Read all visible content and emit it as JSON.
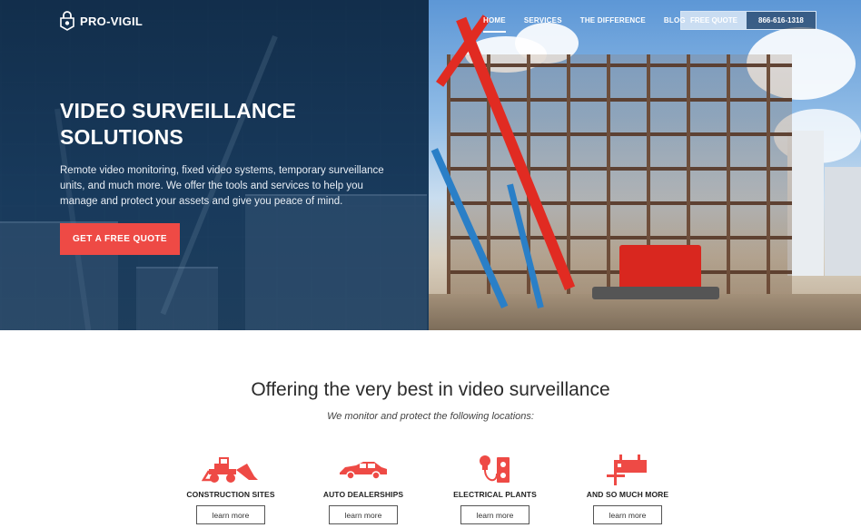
{
  "brand": {
    "name": "PRO-VIGIL",
    "accent": "#ee4a45",
    "navy": "#1b3a5c"
  },
  "nav": {
    "items": [
      {
        "label": "HOME",
        "active": true
      },
      {
        "label": "SERVICES",
        "active": false
      },
      {
        "label": "THE DIFFERENCE",
        "active": false
      },
      {
        "label": "BLOG",
        "active": false
      }
    ],
    "quote_label": "FREE QUOTE",
    "phone": "866-616-1318"
  },
  "hero": {
    "title_line1": "VIDEO SURVEILLANCE",
    "title_line2": "SOLUTIONS",
    "description": "Remote video monitoring, fixed video systems, temporary surveillance units, and much more. We offer the tools and services to help you manage and protect your assets and give you peace of mind.",
    "cta_label": "GET A FREE QUOTE"
  },
  "services_section": {
    "title": "Offering the very best in video surveillance",
    "subtitle": "We monitor and protect the following locations:",
    "items": [
      {
        "label": "CONSTRUCTION SITES",
        "icon": "backhoe-icon",
        "link": "learn more"
      },
      {
        "label": "AUTO DEALERSHIPS",
        "icon": "car-icon",
        "link": "learn more"
      },
      {
        "label": "ELECTRICAL PLANTS",
        "icon": "bulb-outlet-icon",
        "link": "learn more"
      },
      {
        "label": "AND SO MUCH MORE",
        "icon": "trailer-icon",
        "link": "learn more"
      }
    ]
  }
}
